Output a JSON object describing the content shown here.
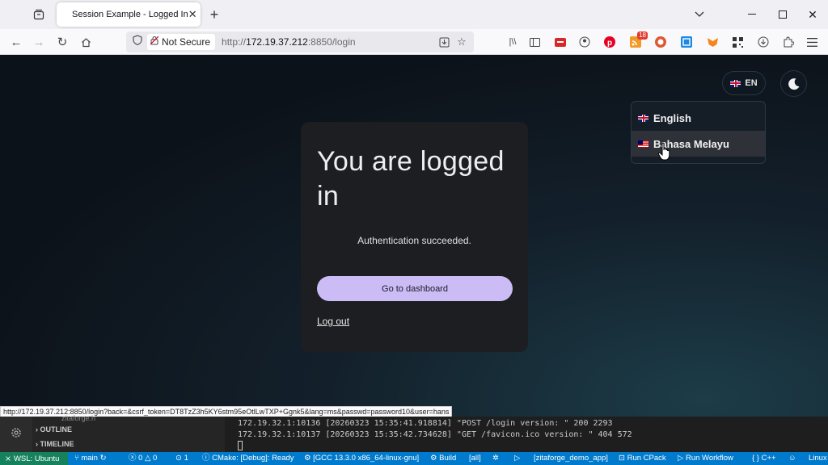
{
  "browser": {
    "tab": {
      "title": "Session Example - Logged In"
    },
    "urlbar": {
      "security_label": "Not Secure",
      "url_prefix": "http://",
      "url_host": "172.19.37.212",
      "url_path": ":8850/login"
    },
    "extensions": {
      "badge_count": "18"
    }
  },
  "page": {
    "lang_button": {
      "code": "EN"
    },
    "lang_menu": {
      "items": [
        "English",
        "Bahasa Melayu"
      ]
    },
    "card": {
      "heading": "You are logged in",
      "message": "Authentication succeeded.",
      "dashboard_button": "Go to dashboard",
      "logout_link": "Log out"
    },
    "colors": {
      "accent": "#cbbcf6",
      "card_bg": "#1d1e21",
      "page_bg": "#0c1219"
    }
  },
  "status_link": "http://172.19.37.212:8850/login?back=&csrf_token=DT8TzZ3h5KY6stm95eOtlLwTXP+Ggnk5&lang=ms&passwd=password10&user=hans",
  "vscode": {
    "sidebar": {
      "file": "zitaforge.h",
      "outline": "OUTLINE",
      "timeline": "TIMELINE"
    },
    "terminal": [
      "172.19.32.1:10136 [20260323 15:35:41.918814] \"POST /login version: \" 200 2293",
      "172.19.32.1:10137 [20260323 15:35:42.734628] \"GET /favicon.ico version: \" 404 572"
    ],
    "statusbar": {
      "remote": "WSL: Ubuntu",
      "branch": "main",
      "errors": "0",
      "warnings": "0",
      "ports": "1",
      "cmake": "CMake: [Debug]: Ready",
      "kit": "[GCC 13.3.0 x86_64-linux-gnu]",
      "build": "Build",
      "target": "[all]",
      "launch": "[zitaforge_demo_app]",
      "cpack": "Run CPack",
      "workflow": "Run Workflow",
      "lang": "C++",
      "os": "Linux"
    }
  }
}
